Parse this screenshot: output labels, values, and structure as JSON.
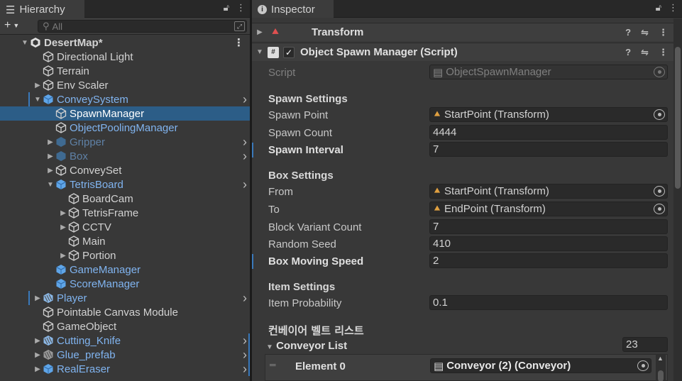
{
  "hierarchy": {
    "tab_label": "Hierarchy",
    "add_label": "+",
    "search_placeholder": "All",
    "scene_name": "DesertMap*",
    "items": [
      {
        "label": "Directional Light"
      },
      {
        "label": "Terrain"
      },
      {
        "label": "Env Scaler"
      },
      {
        "label": "ConveySystem"
      },
      {
        "label": "SpawnManager"
      },
      {
        "label": "ObjectPoolingManager"
      },
      {
        "label": "Gripper"
      },
      {
        "label": "Box"
      },
      {
        "label": "ConveySet"
      },
      {
        "label": "TetrisBoard"
      },
      {
        "label": "BoardCam"
      },
      {
        "label": "TetrisFrame"
      },
      {
        "label": "CCTV"
      },
      {
        "label": "Main"
      },
      {
        "label": "Portion"
      },
      {
        "label": "GameManager"
      },
      {
        "label": "ScoreManager"
      },
      {
        "label": "Player"
      },
      {
        "label": "Pointable Canvas Module"
      },
      {
        "label": "GameObject"
      },
      {
        "label": "Cutting_Knife"
      },
      {
        "label": "Glue_prefab"
      },
      {
        "label": "RealEraser"
      }
    ]
  },
  "inspector": {
    "tab_label": "Inspector",
    "transform_label": "Transform",
    "component_label": "Object Spawn Manager (Script)",
    "script_label": "Script",
    "script_value": "ObjectSpawnManager",
    "spawn_settings": "Spawn Settings",
    "spawn_point_label": "Spawn Point",
    "spawn_point_value": "StartPoint (Transform)",
    "spawn_count_label": "Spawn Count",
    "spawn_count_value": "4444",
    "spawn_interval_label": "Spawn Interval",
    "spawn_interval_value": "7",
    "box_settings": "Box Settings",
    "from_label": "From",
    "from_value": "StartPoint (Transform)",
    "to_label": "To",
    "to_value": "EndPoint (Transform)",
    "block_variant_label": "Block Variant Count",
    "block_variant_value": "7",
    "random_seed_label": "Random Seed",
    "random_seed_value": "410",
    "box_speed_label": "Box Moving Speed",
    "box_speed_value": "2",
    "item_settings": "Item Settings",
    "item_prob_label": "Item Probability",
    "item_prob_value": "0.1",
    "korean_header": "컨베이어 벨트 리스트",
    "conveyor_list_label": "Conveyor List",
    "conveyor_list_count": "23",
    "element0_label": "Element 0",
    "element0_value": "Conveyor (2) (Conveyor)"
  },
  "colors": {
    "selection": "#2c5d87",
    "prefab_blue": "#80b4f0",
    "panel_bg": "#383838"
  }
}
